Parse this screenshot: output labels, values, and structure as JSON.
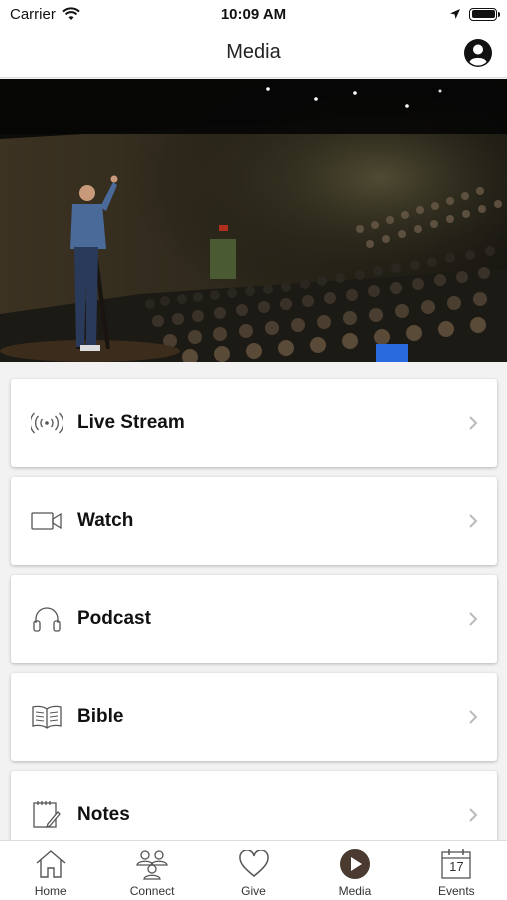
{
  "status_bar": {
    "carrier": "Carrier",
    "time": "10:09 AM"
  },
  "nav": {
    "title": "Media"
  },
  "menu": [
    {
      "label": "Live Stream",
      "icon": "broadcast-icon"
    },
    {
      "label": "Watch",
      "icon": "video-camera-icon"
    },
    {
      "label": "Podcast",
      "icon": "headphones-icon"
    },
    {
      "label": "Bible",
      "icon": "book-icon"
    },
    {
      "label": "Notes",
      "icon": "notes-icon"
    }
  ],
  "tabs": [
    {
      "label": "Home",
      "icon": "home-icon"
    },
    {
      "label": "Connect",
      "icon": "people-icon"
    },
    {
      "label": "Give",
      "icon": "heart-icon"
    },
    {
      "label": "Media",
      "icon": "play-icon",
      "active": true
    },
    {
      "label": "Events",
      "icon": "calendar-icon",
      "date": "17"
    }
  ],
  "colors": {
    "accent": "#4a3a30",
    "icon_gray": "#555555"
  }
}
